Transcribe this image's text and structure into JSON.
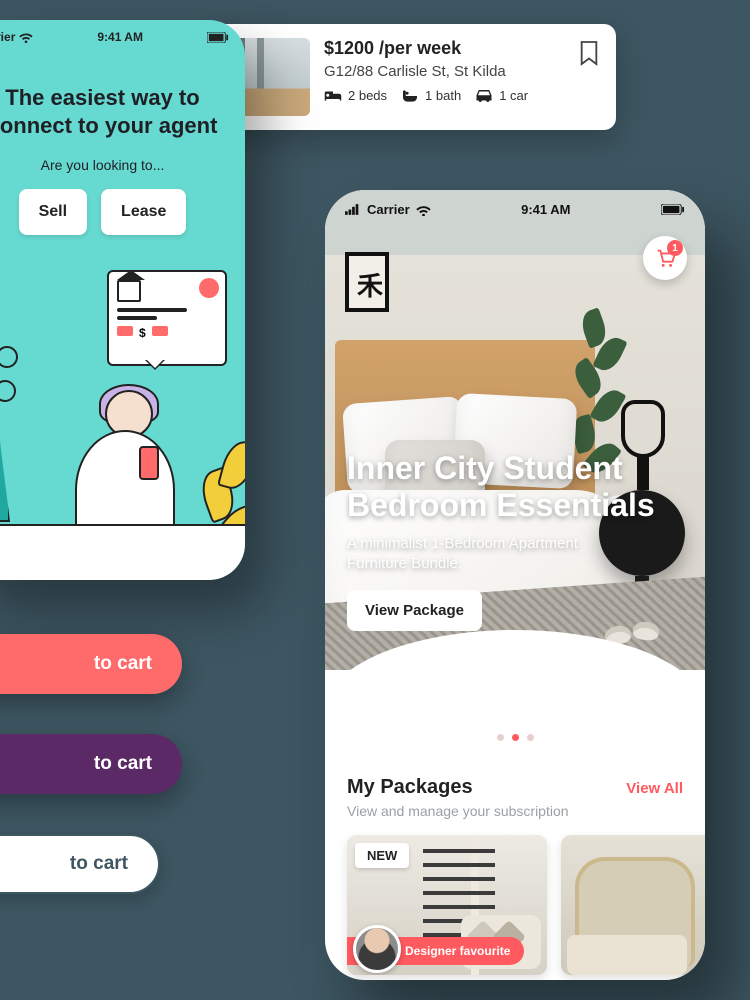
{
  "phone1": {
    "status": {
      "carrier": "Carrier",
      "time": "9:41 AM"
    },
    "headline_line1": "The easiest way to",
    "headline_line2": "connect to your agent",
    "subtext": "Are you looking to...",
    "buttons": {
      "sell": "Sell",
      "lease": "Lease"
    }
  },
  "listing": {
    "price": "$1200 /per week",
    "address": "G12/88 Carlisle St, St Kilda",
    "beds": "2 beds",
    "baths": "1 bath",
    "cars": "1 car"
  },
  "phone2": {
    "status": {
      "carrier": "Carrier",
      "time": "9:41 AM"
    },
    "cart_badge": "1",
    "hero": {
      "title_line1": "Inner City Student",
      "title_line2": "Bedroom Essentials",
      "subtitle": "A minimalist 1-Bedroom Apartment Furniture Bundle.",
      "cta": "View Package"
    },
    "packages": {
      "title": "My Packages",
      "view_all": "View All",
      "subtitle": "View and manage your subscription",
      "card1": {
        "badge": "NEW",
        "ribbon": "Designer favourite"
      }
    }
  },
  "pills": {
    "coral": "to cart",
    "purple": "to cart",
    "outline": "to cart"
  }
}
